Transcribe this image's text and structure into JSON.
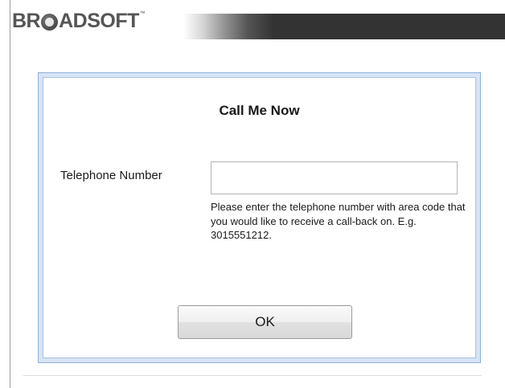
{
  "header": {
    "logo_text_before": "BR",
    "logo_text_after": "ADSOFT",
    "logo_mark": "™"
  },
  "dialog": {
    "title": "Call Me Now",
    "telephone_label": "Telephone Number",
    "telephone_value": "",
    "telephone_placeholder": "",
    "help_text": "Please enter the telephone number with area code that you would like to receive a call-back on. E.g. 3015551212.",
    "ok_label": "OK"
  },
  "colors": {
    "dialog_frame": "#d7e4f5",
    "dialog_border": "#8fb0d8",
    "header_bar": "#333333"
  },
  "icons": {
    "logo_globe": "globe-icon"
  }
}
